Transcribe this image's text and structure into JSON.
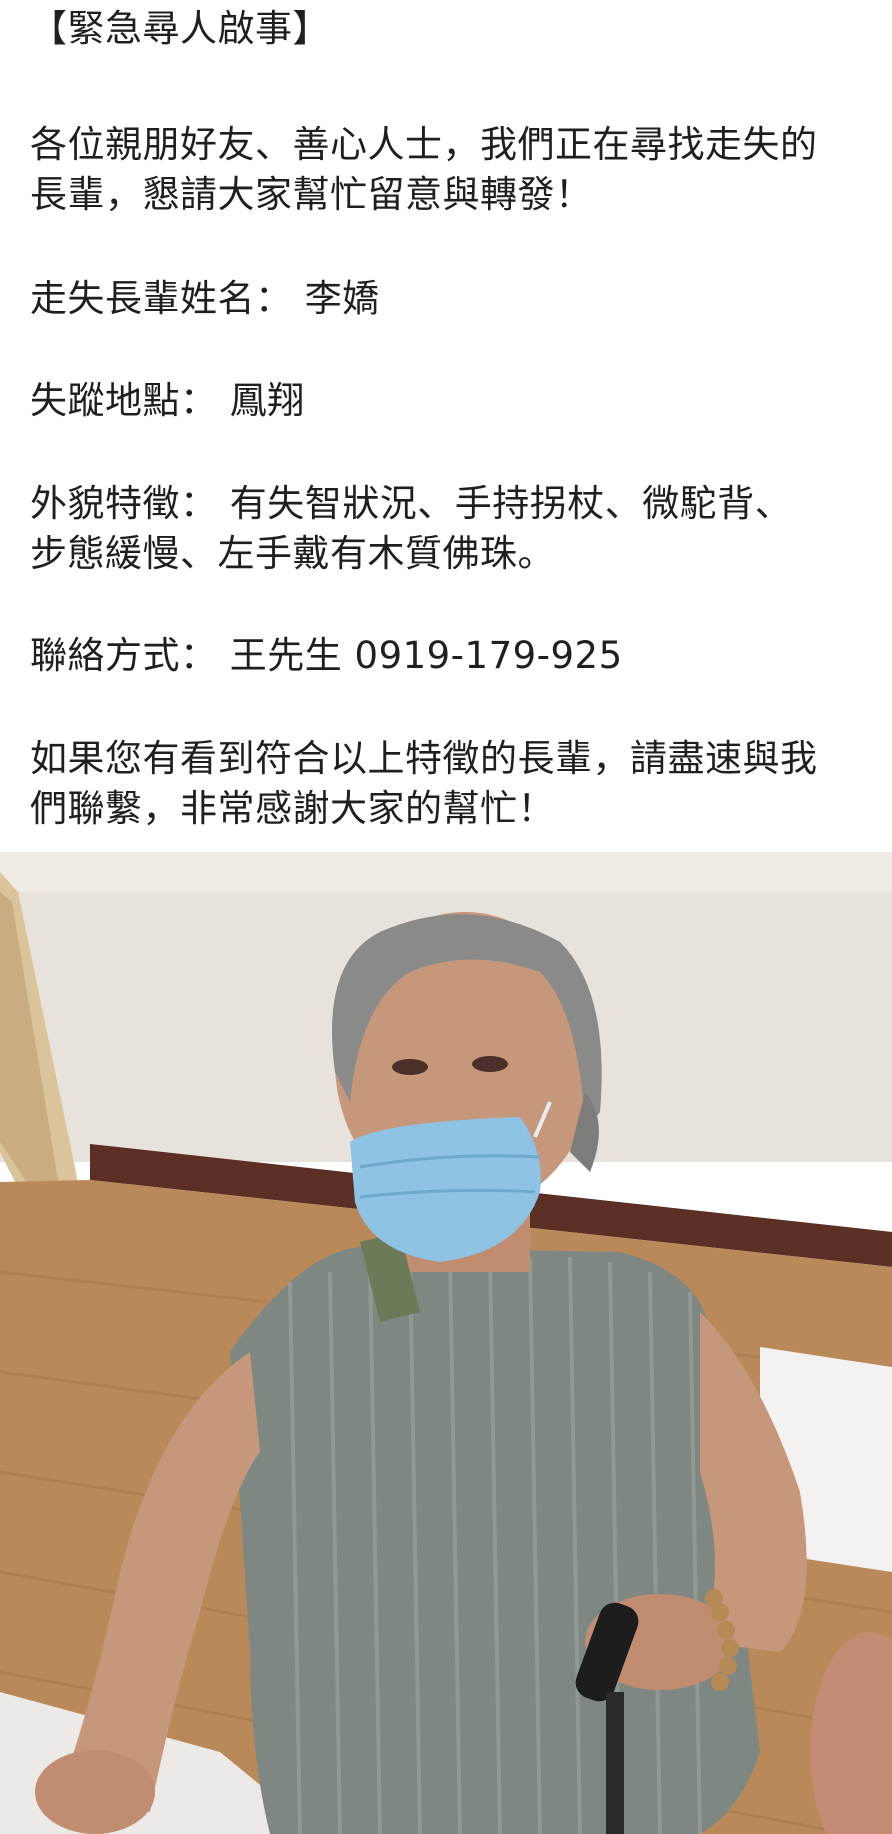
{
  "post": {
    "heading": "【緊急尋人啟事】",
    "intro_line1": "各位親朋好友、善心人士，我們正在尋找走失的",
    "intro_line2": "長輩，懇請大家幫忙留意與轉發！",
    "name_line": "走失長輩姓名： 李嬌",
    "location_line": "失蹤地點： 鳳翔",
    "features_line1": "外貌特徵： 有失智狀況、手持拐杖、微駝背、",
    "features_line2": "步態緩慢、左手戴有木質佛珠。",
    "contact_line": "聯絡方式： 王先生 0919-179-925",
    "closing_line1": "如果您有看到符合以上特徵的長輩，請盡速與我",
    "closing_line2": "們聯繫，非常感謝大家的幫忙！"
  },
  "photo": {
    "subject": "elderly woman wearing blue face mask, seated, holding cane",
    "colors": {
      "wall": "#e8e3dc",
      "floor": "#b98a5c",
      "baseboard": "#5a2e22",
      "mask": "#8ec3e3",
      "dress": "#7f8783",
      "hair": "#8a8a88",
      "skin": "#c7977c"
    }
  }
}
